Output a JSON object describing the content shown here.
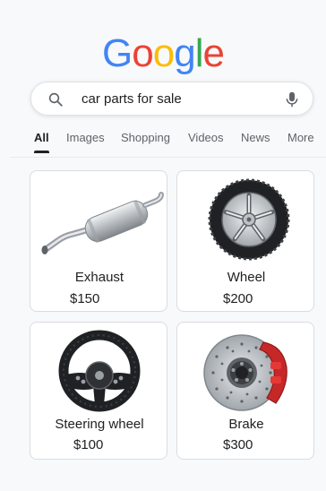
{
  "logo": {
    "letters": [
      "G",
      "o",
      "o",
      "g",
      "l",
      "e"
    ],
    "colors": [
      "#4285F4",
      "#EA4335",
      "#FBBC05",
      "#4285F4",
      "#34A853",
      "#EA4335"
    ]
  },
  "search": {
    "query": "car parts for sale",
    "icon": "magnifier-icon",
    "mic_icon": "microphone-icon"
  },
  "tabs": [
    {
      "label": "All",
      "active": true
    },
    {
      "label": "Images",
      "active": false
    },
    {
      "label": "Shopping",
      "active": false
    },
    {
      "label": "Videos",
      "active": false
    },
    {
      "label": "News",
      "active": false
    },
    {
      "label": "More",
      "active": false
    }
  ],
  "products": [
    {
      "name": "Exhaust",
      "price": "$150",
      "icon": "exhaust-muffler-icon"
    },
    {
      "name": "Wheel",
      "price": "$200",
      "icon": "tire-wheel-icon"
    },
    {
      "name": "Steering wheel",
      "price": "$100",
      "icon": "steering-wheel-icon"
    },
    {
      "name": "Brake",
      "price": "$300",
      "icon": "brake-disc-caliper-icon"
    }
  ],
  "colors": {
    "background": "#f8f9fa",
    "text": "#202124",
    "muted": "#5f6368",
    "border": "#dadce0",
    "caliper": "#c62828"
  }
}
